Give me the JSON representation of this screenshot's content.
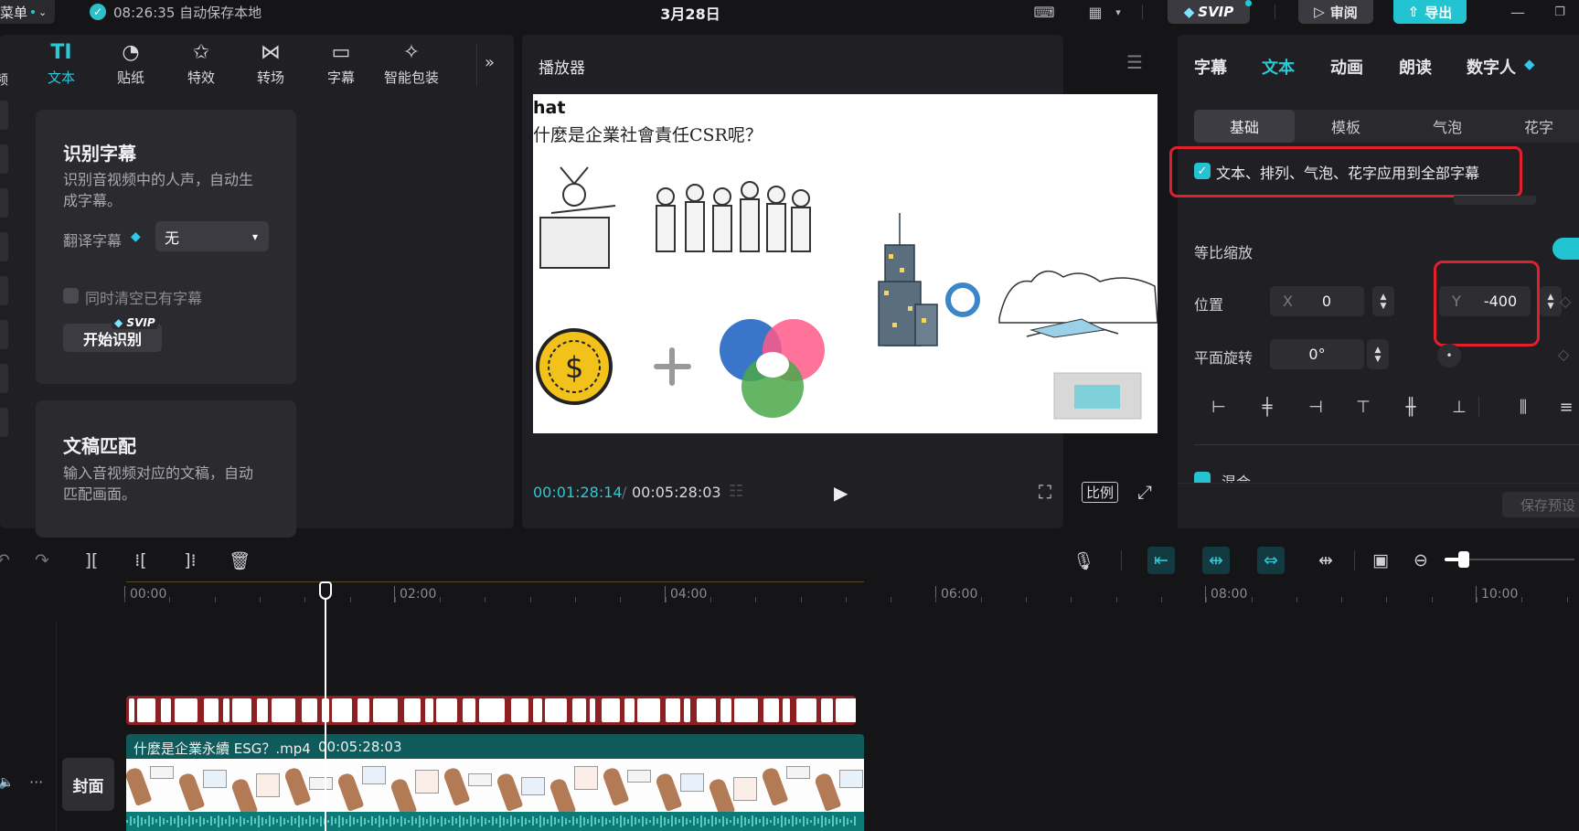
{
  "titlebar": {
    "menu_label": "菜单",
    "save_status": "08:26:35 自动保存本地",
    "project_title": "3月28日",
    "svip_label": "SVIP",
    "review_label": "审阅",
    "export_label": "导出"
  },
  "left_panel": {
    "cut_label": "频",
    "tabs": [
      {
        "label": "文本",
        "icon": "text-icon",
        "active": true
      },
      {
        "label": "贴纸",
        "icon": "sticker-icon",
        "active": false
      },
      {
        "label": "特效",
        "icon": "effects-icon",
        "active": false
      },
      {
        "label": "转场",
        "icon": "transition-icon",
        "active": false
      },
      {
        "label": "字幕",
        "icon": "subtitle-icon",
        "active": false
      },
      {
        "label": "智能包装",
        "icon": "smart-pack-icon",
        "active": false
      }
    ],
    "recognize_card": {
      "title": "识别字幕",
      "desc_line1": "识别音视频中的人声，自动生",
      "desc_line2": "成字幕。",
      "translate_label": "翻译字幕",
      "translate_value": "无",
      "clear_label": "同时清空已有字幕",
      "start_label": "开始识别",
      "svip_badge": "SVIP"
    },
    "match_card": {
      "title": "文稿匹配",
      "desc_line1": "输入音视频对应的文稿，自动",
      "desc_line2": "匹配画面。"
    }
  },
  "player": {
    "title": "播放器",
    "video_heading": "hat",
    "video_question": "什麼是企業社會責任CSR呢？",
    "current_time": "00:01:28:14",
    "total_time": "00:05:28:03",
    "ratio_label": "比例"
  },
  "inspector": {
    "tabs": [
      {
        "label": "字幕",
        "active": false
      },
      {
        "label": "文本",
        "active": true
      },
      {
        "label": "动画",
        "active": false
      },
      {
        "label": "朗读",
        "active": false
      },
      {
        "label": "数字人",
        "active": false
      }
    ],
    "subtabs": [
      {
        "label": "基础",
        "active": true
      },
      {
        "label": "模板",
        "active": false
      },
      {
        "label": "气泡",
        "active": false
      },
      {
        "label": "花字",
        "active": false
      }
    ],
    "apply_all_label": "文本、排列、气泡、花字应用到全部字幕",
    "scale_label": "等比缩放",
    "position_label": "位置",
    "x_axis": "X",
    "x_value": "0",
    "y_axis": "Y",
    "y_value": "-400",
    "rotation_label": "平面旋转",
    "rotation_value": "0°",
    "mix_label": "混合",
    "save_preset_label": "保存预设"
  },
  "timeline": {
    "ticks": [
      "00:00",
      "02:00",
      "04:00",
      "06:00",
      "08:00",
      "10:00"
    ],
    "clip_name": "什麼是企業永續 ESG？.mp4",
    "clip_duration": "00:05:28:03",
    "cover_label": "封面"
  }
}
